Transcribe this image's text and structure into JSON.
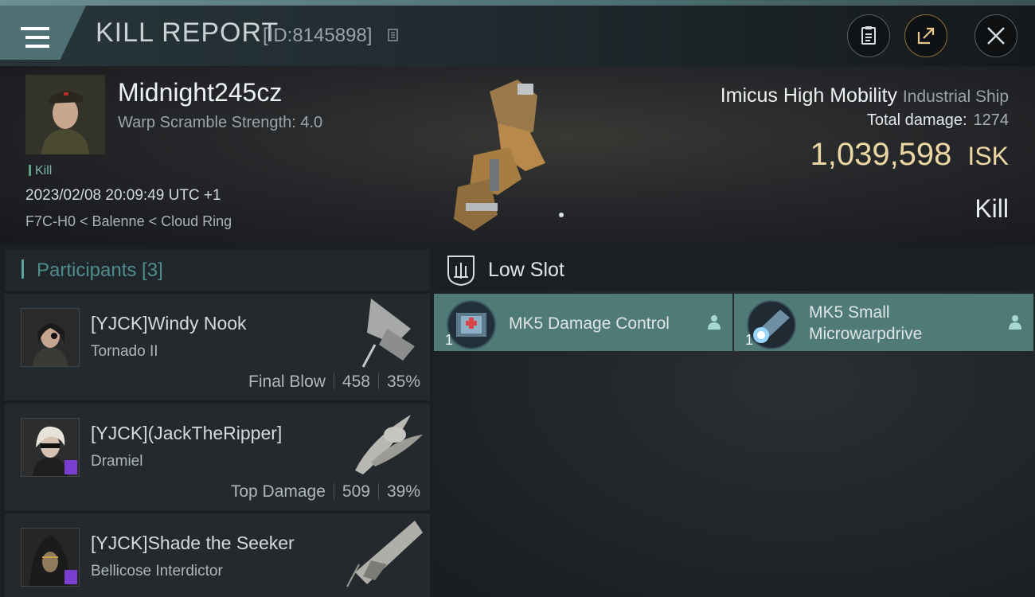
{
  "header": {
    "title": "KILL REPORT",
    "report_id": "[ID:8145898]",
    "icons": [
      "menu-icon",
      "copy-icon",
      "clipboard-icon",
      "share-icon",
      "close-icon"
    ]
  },
  "victim": {
    "name": "Midnight245cz",
    "warp_scramble": "Warp Scramble Strength: 4.0",
    "tag": "Kill",
    "datetime": "2023/02/08 20:09:49 UTC +1",
    "location": "F7C-H0 < Balenne < Cloud Ring",
    "ship_name": "Imicus High Mobility",
    "ship_class": "Industrial Ship",
    "total_damage_label": "Total damage:",
    "total_damage": "1274",
    "isk_value": "1,039,598",
    "isk_unit": "ISK",
    "result": "Kill"
  },
  "participants": {
    "title": "Participants [3]",
    "items": [
      {
        "name": "[YJCK]Windy Nook",
        "ship": "Tornado II",
        "label": "Final Blow",
        "damage": "458",
        "percent": "35%"
      },
      {
        "name": "[YJCK](JackTheRipper]",
        "ship": "Dramiel",
        "label": "Top Damage",
        "damage": "509",
        "percent": "39%"
      },
      {
        "name": "[YJCK]Shade the Seeker",
        "ship": "Bellicose Interdictor",
        "label": "",
        "damage": "",
        "percent": ""
      }
    ]
  },
  "low_slot": {
    "title": "Low Slot",
    "modules": [
      {
        "qty": "1",
        "name_line1": "MK5 Damage Control",
        "name_line2": ""
      },
      {
        "qty": "1",
        "name_line1": "MK5 Small",
        "name_line2": "Microwarpdrive"
      }
    ]
  },
  "colors": {
    "accent": "#4f7a78",
    "isk": "#ecd6a4",
    "purple_badge": "#7b3fd0"
  }
}
